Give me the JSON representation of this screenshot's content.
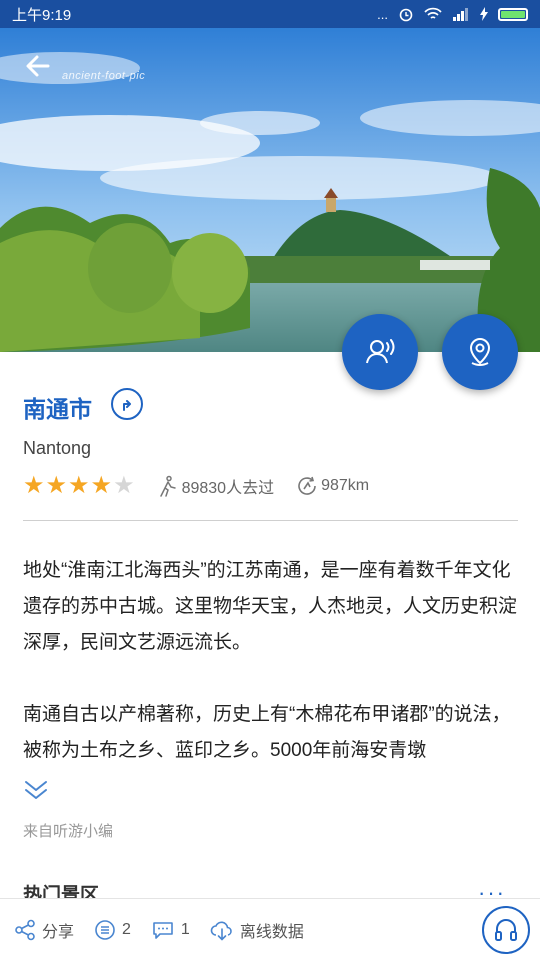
{
  "status_bar": {
    "time": "上午9:19",
    "dots": "...",
    "signal": "4"
  },
  "hero": {
    "watermark": "ancient-foot-pic"
  },
  "city": {
    "name": "南通市",
    "name_en": "Nantong",
    "rating": 4,
    "rating_max": 5,
    "visitors": "89830人去过",
    "distance": "987km"
  },
  "description": {
    "paragraphs": [
      "地处“淮南江北海西头”的江苏南通，是一座有着数千年文化遗存的苏中古城。这里物华天宝，人杰地灵，人文历史积淀深厚，民间文艺源远流长。",
      "南通自古以产棉著称，历史上有“木棉花布甲诸郡”的说法，被称为土布之乡、蓝印之乡。5000年前海安青墩"
    ],
    "source": "来自听游小编"
  },
  "section": {
    "title": "热门景区",
    "more": "···"
  },
  "bottom_bar": {
    "share_label": "分享",
    "comments_count": "2",
    "messages_count": "1",
    "offline_label": "离线数据"
  },
  "colors": {
    "brand": "#1e63c2",
    "star": "#f5a623",
    "status_bar": "#1a4fa0"
  }
}
